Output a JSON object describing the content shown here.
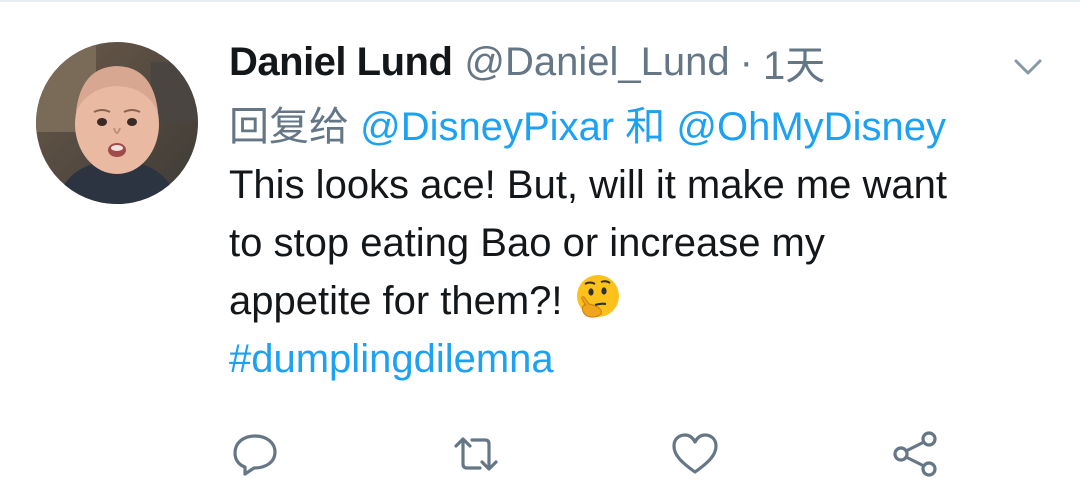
{
  "tweet": {
    "author": {
      "display_name": "Daniel Lund",
      "handle": "@Daniel_Lund",
      "separator": "·",
      "time_ago": "1天"
    },
    "reply_to": {
      "prefix": "回复给",
      "mention_1": "@DisneyPixar",
      "conjunction": "和",
      "mention_2": "@OhMyDisney"
    },
    "body_lines": [
      "This looks ace! But, will it make me want",
      "to stop eating Bao or increase my",
      "appetite for them?!"
    ],
    "emoji": "thinking-face",
    "hashtag": "#dumplingdilemna"
  },
  "actions": [
    {
      "name": "reply",
      "icon": "reply-icon"
    },
    {
      "name": "retweet",
      "icon": "retweet-icon"
    },
    {
      "name": "like",
      "icon": "heart-icon"
    },
    {
      "name": "share",
      "icon": "share-icon"
    }
  ],
  "colors": {
    "link": "#1da1f2",
    "text": "#14171a",
    "secondary": "#657786",
    "icon": "#657786"
  }
}
